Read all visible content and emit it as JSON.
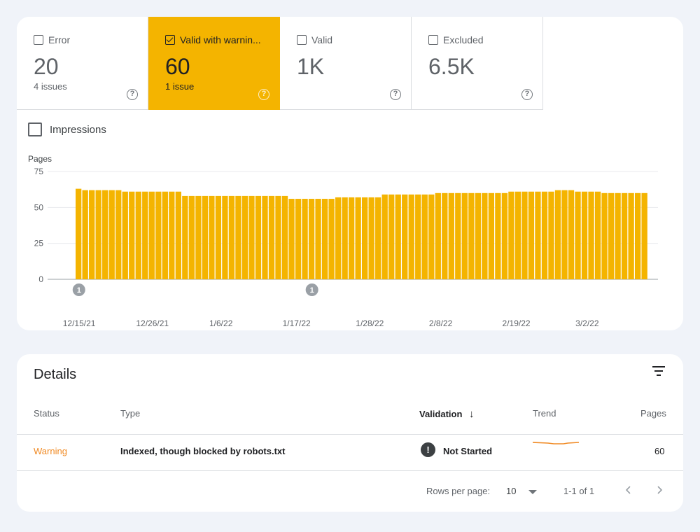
{
  "tiles": [
    {
      "label": "Error",
      "value": "20",
      "sub": "4 issues",
      "selected": false
    },
    {
      "label": "Valid with warnin...",
      "value": "60",
      "sub": "1 issue",
      "selected": true
    },
    {
      "label": "Valid",
      "value": "1K",
      "sub": "",
      "selected": false
    },
    {
      "label": "Excluded",
      "value": "6.5K",
      "sub": "",
      "selected": false
    }
  ],
  "help_glyph": "?",
  "impressions": {
    "label": "Impressions",
    "checked": false
  },
  "chart_data": {
    "type": "bar",
    "ylabel": "Pages",
    "ylim": [
      0,
      75
    ],
    "yticks": [
      0,
      25,
      50,
      75
    ],
    "xtick_labels": [
      "12/15/21",
      "12/26/21",
      "1/6/22",
      "1/17/22",
      "1/28/22",
      "2/8/22",
      "2/19/22",
      "3/2/22"
    ],
    "start_date": "2021-12-15",
    "color": "#f4b400",
    "annotations": [
      {
        "date": "2021-12-15",
        "label": "1"
      },
      {
        "date": "2022-01-19",
        "label": "1"
      }
    ],
    "values": [
      63,
      62,
      62,
      62,
      62,
      62,
      62,
      61,
      61,
      61,
      61,
      61,
      61,
      61,
      61,
      61,
      58,
      58,
      58,
      58,
      58,
      58,
      58,
      58,
      58,
      58,
      58,
      58,
      58,
      58,
      58,
      58,
      56,
      56,
      56,
      56,
      56,
      56,
      56,
      57,
      57,
      57,
      57,
      57,
      57,
      57,
      59,
      59,
      59,
      59,
      59,
      59,
      59,
      59,
      60,
      60,
      60,
      60,
      60,
      60,
      60,
      60,
      60,
      60,
      60,
      61,
      61,
      61,
      61,
      61,
      61,
      61,
      62,
      62,
      62,
      61,
      61,
      61,
      61,
      60,
      60,
      60,
      60,
      60,
      60,
      60
    ]
  },
  "details": {
    "title": "Details",
    "columns": {
      "status": "Status",
      "type": "Type",
      "validation": "Validation",
      "trend": "Trend",
      "pages": "Pages"
    },
    "sort_arrow": "↓",
    "row": {
      "status": "Warning",
      "type": "Indexed, though blocked by robots.txt",
      "validation": "Not Started",
      "validation_glyph": "!",
      "pages": "60"
    },
    "footer": {
      "rows_per_page_label": "Rows per page:",
      "rows_per_page_value": "10",
      "range": "1-1 of 1"
    }
  },
  "colors": {
    "accent": "#f4b400",
    "warning": "#f08a24",
    "trend": "#f08a24"
  }
}
